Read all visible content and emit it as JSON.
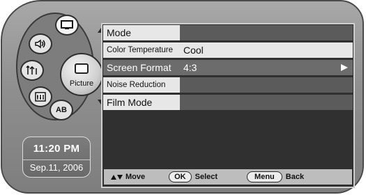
{
  "menu": {
    "rows": [
      {
        "label": "Mode",
        "value": ""
      },
      {
        "label": "Color Temperature",
        "value": "Cool"
      },
      {
        "label": "Screen Format",
        "value": "4:3"
      },
      {
        "label": "Noise Reduction",
        "value": ""
      },
      {
        "label": "Film Mode",
        "value": ""
      }
    ],
    "selected_index": 2
  },
  "wheel": {
    "center_label": "Picture",
    "ab_label": "AB",
    "icons": [
      "tv-screen-icon",
      "speaker-icon",
      "antenna-icon",
      "meter-icon",
      "ab-icon"
    ]
  },
  "clock": {
    "time": "11:20 PM",
    "date": "Sep.11, 2006"
  },
  "bottom_bar": {
    "move_label": "Move",
    "ok_button": "OK",
    "select_label": "Select",
    "menu_button": "Menu",
    "back_label": "Back"
  }
}
